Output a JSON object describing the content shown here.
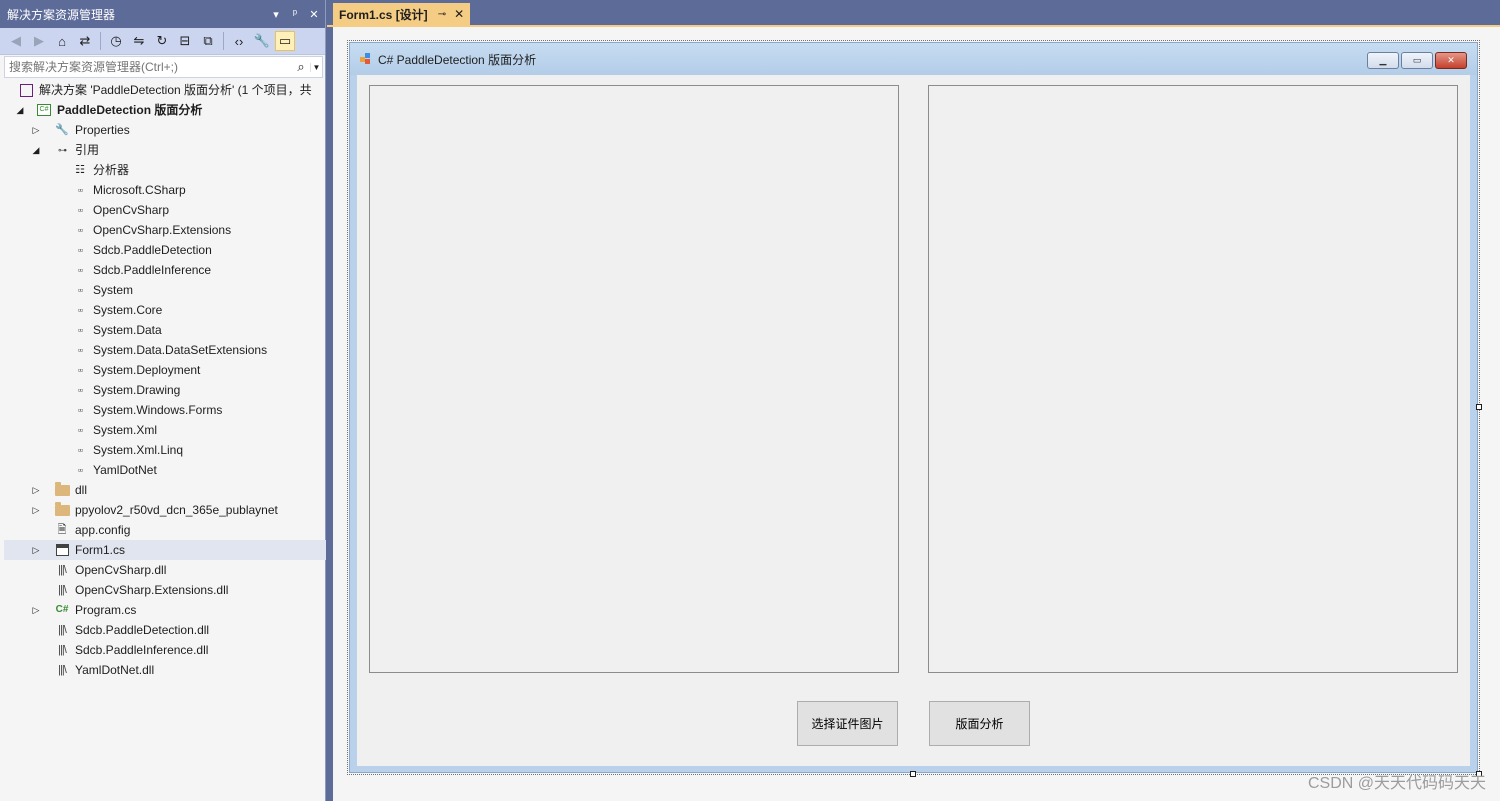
{
  "solution_explorer": {
    "title": "解决方案资源管理器",
    "title_buttons": [
      "▾",
      "ᵖ",
      "✕"
    ],
    "search_placeholder": "搜索解决方案资源管理器(Ctrl+;)",
    "tree": {
      "solution": "解决方案 'PaddleDetection 版面分析' (1 个项目，共",
      "project": "PaddleDetection 版面分析",
      "properties": "Properties",
      "references": "引用",
      "analyzers": "分析器",
      "refs": [
        "Microsoft.CSharp",
        "OpenCvSharp",
        "OpenCvSharp.Extensions",
        "Sdcb.PaddleDetection",
        "Sdcb.PaddleInference",
        "System",
        "System.Core",
        "System.Data",
        "System.Data.DataSetExtensions",
        "System.Deployment",
        "System.Drawing",
        "System.Windows.Forms",
        "System.Xml",
        "System.Xml.Linq",
        "YamlDotNet"
      ],
      "folder_dll": "dll",
      "folder_model": "ppyolov2_r50vd_dcn_365e_publaynet",
      "app_config": "app.config",
      "form1": "Form1.cs",
      "dll1": "OpenCvSharp.dll",
      "dll2": "OpenCvSharp.Extensions.dll",
      "program": "Program.cs",
      "dll3": "Sdcb.PaddleDetection.dll",
      "dll4": "Sdcb.PaddleInference.dll",
      "dll5": "YamlDotNet.dll"
    }
  },
  "tab": {
    "label": "Form1.cs [设计]"
  },
  "form": {
    "caption": "C# PaddleDetection 版面分析",
    "button_select": "选择证件图片",
    "button_analyze": "版面分析"
  },
  "watermark": "CSDN @天天代码码天天",
  "colors": {
    "chrome": "#5d6b99",
    "tab_active": "#f5cc84",
    "form_border": "#b9d1ea"
  }
}
